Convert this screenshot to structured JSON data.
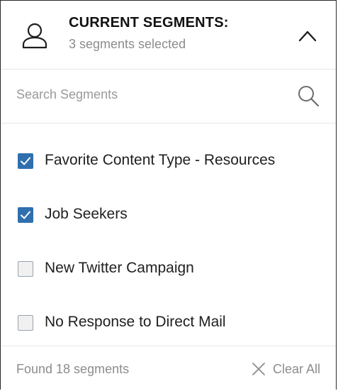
{
  "header": {
    "title": "CURRENT SEGMENTS:",
    "subtitle": "3 segments selected",
    "icon": "user-icon",
    "toggle_icon": "chevron-up-icon"
  },
  "search": {
    "placeholder": "Search Segments",
    "value": "",
    "icon": "search-icon"
  },
  "segments": [
    {
      "label": "Favorite Content Type - Resources",
      "checked": true
    },
    {
      "label": "Job Seekers",
      "checked": true
    },
    {
      "label": "New Twitter Campaign",
      "checked": false
    },
    {
      "label": "No Response to Direct Mail",
      "checked": false
    }
  ],
  "footer": {
    "found_text": "Found 18 segments",
    "clear_label": "Clear All",
    "clear_icon": "close-icon"
  },
  "colors": {
    "checkbox_checked": "#2f6fae",
    "muted_text": "#8c8c8c",
    "divider": "#e6e6e6"
  }
}
